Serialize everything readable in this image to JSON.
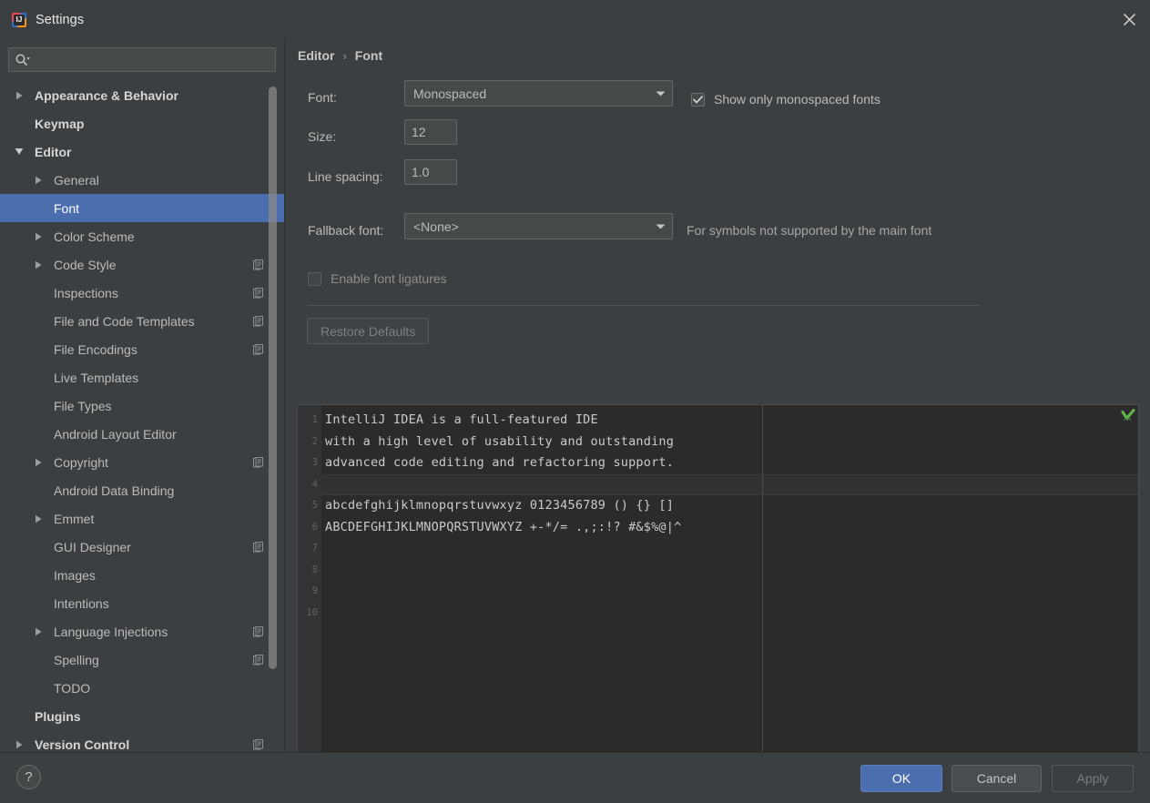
{
  "window": {
    "title": "Settings",
    "app_icon": "intellij-idea-icon",
    "close_icon": "close-icon"
  },
  "sidebar": {
    "search": {
      "placeholder": "",
      "value": "",
      "icon": "search-icon"
    },
    "items": [
      {
        "label": "Appearance & Behavior",
        "indent": 0,
        "arrow": "collapsed",
        "bold": true,
        "config": false,
        "selected": false
      },
      {
        "label": "Keymap",
        "indent": 0,
        "arrow": "none",
        "bold": true,
        "config": false,
        "selected": false
      },
      {
        "label": "Editor",
        "indent": 0,
        "arrow": "expanded",
        "bold": true,
        "config": false,
        "selected": false
      },
      {
        "label": "General",
        "indent": 1,
        "arrow": "collapsed",
        "bold": false,
        "config": false,
        "selected": false
      },
      {
        "label": "Font",
        "indent": 1,
        "arrow": "none",
        "bold": false,
        "config": false,
        "selected": true
      },
      {
        "label": "Color Scheme",
        "indent": 1,
        "arrow": "collapsed",
        "bold": false,
        "config": false,
        "selected": false
      },
      {
        "label": "Code Style",
        "indent": 1,
        "arrow": "collapsed",
        "bold": false,
        "config": true,
        "selected": false
      },
      {
        "label": "Inspections",
        "indent": 1,
        "arrow": "none",
        "bold": false,
        "config": true,
        "selected": false
      },
      {
        "label": "File and Code Templates",
        "indent": 1,
        "arrow": "none",
        "bold": false,
        "config": true,
        "selected": false
      },
      {
        "label": "File Encodings",
        "indent": 1,
        "arrow": "none",
        "bold": false,
        "config": true,
        "selected": false
      },
      {
        "label": "Live Templates",
        "indent": 1,
        "arrow": "none",
        "bold": false,
        "config": false,
        "selected": false
      },
      {
        "label": "File Types",
        "indent": 1,
        "arrow": "none",
        "bold": false,
        "config": false,
        "selected": false
      },
      {
        "label": "Android Layout Editor",
        "indent": 1,
        "arrow": "none",
        "bold": false,
        "config": false,
        "selected": false
      },
      {
        "label": "Copyright",
        "indent": 1,
        "arrow": "collapsed",
        "bold": false,
        "config": true,
        "selected": false
      },
      {
        "label": "Android Data Binding",
        "indent": 1,
        "arrow": "none",
        "bold": false,
        "config": false,
        "selected": false
      },
      {
        "label": "Emmet",
        "indent": 1,
        "arrow": "collapsed",
        "bold": false,
        "config": false,
        "selected": false
      },
      {
        "label": "GUI Designer",
        "indent": 1,
        "arrow": "none",
        "bold": false,
        "config": true,
        "selected": false
      },
      {
        "label": "Images",
        "indent": 1,
        "arrow": "none",
        "bold": false,
        "config": false,
        "selected": false
      },
      {
        "label": "Intentions",
        "indent": 1,
        "arrow": "none",
        "bold": false,
        "config": false,
        "selected": false
      },
      {
        "label": "Language Injections",
        "indent": 1,
        "arrow": "collapsed",
        "bold": false,
        "config": true,
        "selected": false
      },
      {
        "label": "Spelling",
        "indent": 1,
        "arrow": "none",
        "bold": false,
        "config": true,
        "selected": false
      },
      {
        "label": "TODO",
        "indent": 1,
        "arrow": "none",
        "bold": false,
        "config": false,
        "selected": false
      },
      {
        "label": "Plugins",
        "indent": 0,
        "arrow": "none",
        "bold": true,
        "config": false,
        "selected": false
      },
      {
        "label": "Version Control",
        "indent": 0,
        "arrow": "collapsed",
        "bold": true,
        "config": true,
        "selected": false
      }
    ]
  },
  "main": {
    "breadcrumb": {
      "parent": "Editor",
      "separator": "›",
      "current": "Font"
    },
    "font_label": "Font:",
    "font_value": "Monospaced",
    "show_monospaced_label": "Show only monospaced fonts",
    "show_monospaced_checked": true,
    "size_label": "Size:",
    "size_value": "12",
    "line_spacing_label": "Line spacing:",
    "line_spacing_value": "1.0",
    "fallback_label": "Fallback font:",
    "fallback_value": "<None>",
    "fallback_hint": "For symbols not supported by the main font",
    "ligatures_label": "Enable font ligatures",
    "ligatures_checked": false,
    "restore_defaults_label": "Restore Defaults"
  },
  "preview": {
    "inspect_icon": "inspection-ok-icon",
    "line_numbers": [
      "1",
      "2",
      "3",
      "4",
      "5",
      "6",
      "7",
      "8",
      "9",
      "10"
    ],
    "current_line": 4,
    "lines": [
      "IntelliJ IDEA is a full-featured IDE",
      "with a high level of usability and outstanding",
      "advanced code editing and refactoring support.",
      "",
      "abcdefghijklmnopqrstuvwxyz 0123456789 () {} []",
      "ABCDEFGHIJKLMNOPQRSTUVWXYZ +-*/= .,;:!? #&$%@|^"
    ]
  },
  "footer": {
    "help_label": "?",
    "ok_label": "OK",
    "cancel_label": "Cancel",
    "apply_label": "Apply"
  },
  "colors": {
    "window_bg": "#3c3f41",
    "selection": "#4b6eaf",
    "editor_bg": "#2b2b2b",
    "gutter_bg": "#313335",
    "text": "#bbbbbb",
    "inspect_green": "#5a9e4b"
  }
}
